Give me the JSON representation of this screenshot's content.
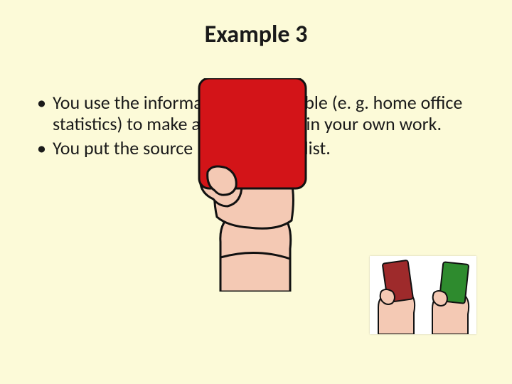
{
  "title": "Example 3",
  "bullets": [
    "You use the information from a table (e. g. home office statistics) to make a new diagram in your own work.",
    "You put the source in a reference list."
  ],
  "icons": {
    "center_card_color": "#D31418",
    "skin": "#F4C9B4",
    "skin_shadow": "#E7A98E",
    "outline": "#111111",
    "small_left_card": "#9E2A2B",
    "small_right_card": "#2E8B2E"
  }
}
